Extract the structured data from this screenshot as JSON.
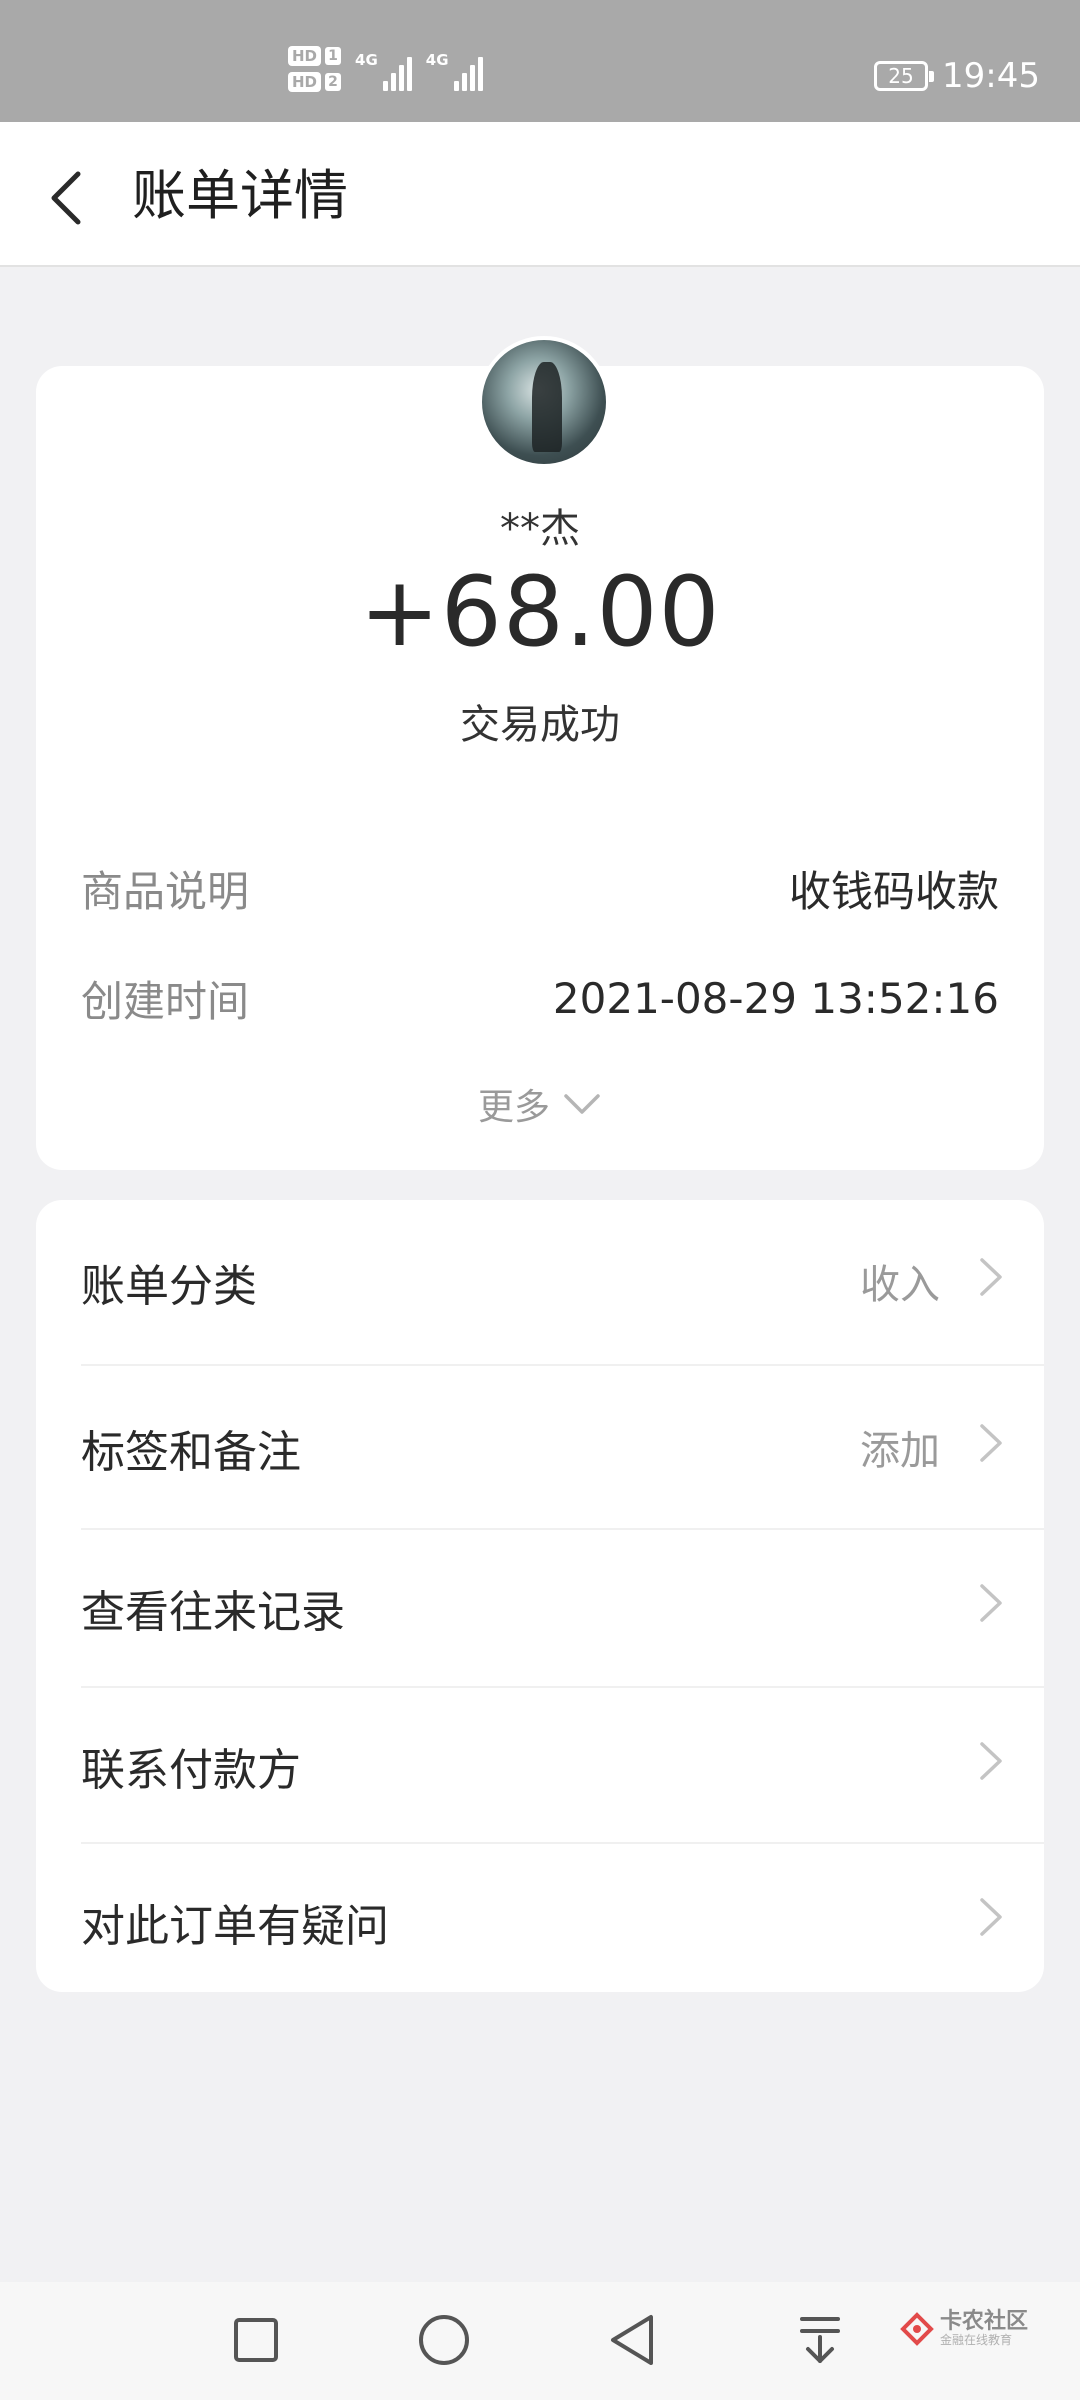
{
  "status_bar": {
    "hd1": "HD",
    "sim1": "1",
    "hd2": "HD",
    "sim2": "2",
    "net1": "4G",
    "net2": "4G",
    "battery": "25",
    "time": "19:45"
  },
  "header": {
    "title": "账单详情"
  },
  "transaction": {
    "payer": "**杰",
    "amount": "+68.00",
    "status": "交易成功",
    "details": [
      {
        "label": "商品说明",
        "value": "收钱码收款"
      },
      {
        "label": "创建时间",
        "value": "2021-08-29 13:52:16"
      }
    ],
    "more_label": "更多"
  },
  "actions": [
    {
      "label": "账单分类",
      "value": "收入"
    },
    {
      "label": "标签和备注",
      "value": "添加"
    },
    {
      "label": "查看往来记录",
      "value": ""
    },
    {
      "label": "联系付款方",
      "value": ""
    },
    {
      "label": "对此订单有疑问",
      "value": ""
    }
  ],
  "watermark": {
    "main": "卡农社区",
    "sub": "金融在线教育"
  },
  "colors": {
    "status_bar_bg": "#a9a9a9",
    "page_bg": "#f1f1f3",
    "card_bg": "#ffffff",
    "label_gray": "#8a8a8a",
    "text_dark": "#2a2a2a"
  }
}
